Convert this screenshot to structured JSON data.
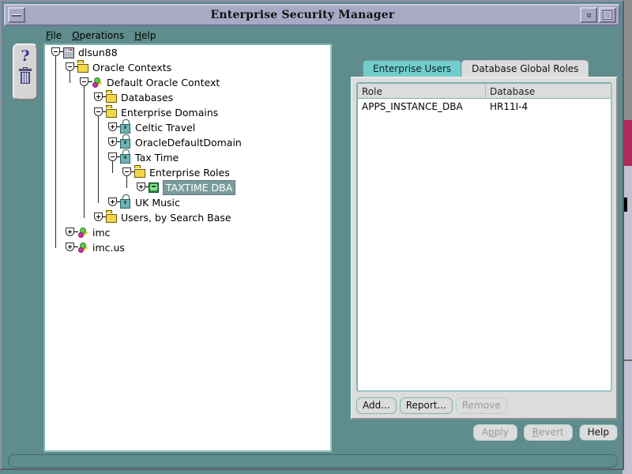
{
  "window": {
    "title": "Enterprise Security Manager",
    "menu_button_icon": "window-menu-icon",
    "minimize_icon": "minimize-icon",
    "maximize_icon": "maximize-icon"
  },
  "menubar": {
    "items": [
      {
        "label": "File",
        "mnemonic": "F"
      },
      {
        "label": "Operations",
        "mnemonic": "O"
      },
      {
        "label": "Help",
        "mnemonic": "H"
      }
    ]
  },
  "toolbar": {
    "help_icon": "question-mark-icon",
    "help_glyph": "?",
    "delete_icon": "trash-can-icon"
  },
  "tree": {
    "nodes": [
      {
        "label": "dlsun88",
        "depth": 0,
        "icon": "host-icon",
        "expander": "collapse-handle"
      },
      {
        "label": "Oracle Contexts",
        "depth": 1,
        "icon": "folder-icon",
        "expander": "collapse-handle"
      },
      {
        "label": "Default Oracle Context",
        "depth": 2,
        "icon": "context-icon",
        "expander": "collapse-handle"
      },
      {
        "label": "Databases",
        "depth": 3,
        "icon": "folder-icon",
        "expander": "expand-handle"
      },
      {
        "label": "Enterprise Domains",
        "depth": 3,
        "icon": "folder-icon",
        "expander": "collapse-handle"
      },
      {
        "label": "Celtic Travel",
        "depth": 4,
        "icon": "lock-icon",
        "expander": "expand-handle"
      },
      {
        "label": "OracleDefaultDomain",
        "depth": 4,
        "icon": "lock-icon",
        "expander": "expand-handle"
      },
      {
        "label": "Tax Time",
        "depth": 4,
        "icon": "lock-icon",
        "expander": "collapse-handle"
      },
      {
        "label": "Enterprise Roles",
        "depth": 5,
        "icon": "folder-icon",
        "expander": "collapse-handle"
      },
      {
        "label": "TAXTIME DBA",
        "depth": 6,
        "icon": "role-icon",
        "expander": "expand-handle",
        "selected": true
      },
      {
        "label": "UK Music",
        "depth": 4,
        "icon": "lock-icon",
        "expander": "expand-handle"
      },
      {
        "label": "Users, by Search Base",
        "depth": 3,
        "icon": "folder-icon",
        "expander": "expand-handle"
      },
      {
        "label": "imc",
        "depth": 1,
        "icon": "context-icon",
        "expander": "expand-handle"
      },
      {
        "label": "imc.us",
        "depth": 1,
        "icon": "context-icon",
        "expander": "expand-handle"
      }
    ]
  },
  "right_panel": {
    "tabs": [
      {
        "label": "Enterprise Users",
        "active": false
      },
      {
        "label": "Database Global Roles",
        "active": true
      }
    ],
    "table": {
      "columns": [
        "Role",
        "Database"
      ],
      "rows": [
        {
          "role": "APPS_INSTANCE_DBA",
          "database": "HR11I-4"
        }
      ]
    },
    "actions": [
      {
        "label": "Add...",
        "enabled": true
      },
      {
        "label": "Report...",
        "enabled": true
      },
      {
        "label": "Remove",
        "enabled": false
      }
    ]
  },
  "bottom_actions": [
    {
      "label": "Apply",
      "mnemonic": "p",
      "enabled": false
    },
    {
      "label": "Revert",
      "mnemonic": "R",
      "enabled": false
    },
    {
      "label": "Help",
      "mnemonic": "",
      "enabled": true
    }
  ],
  "status_bar": {
    "text": ""
  },
  "colors": {
    "desktop": "#5f8c8c",
    "titlebar": "#a9a9c6",
    "panel": "#dcdcdc",
    "tab_inactive": "#73cdcd",
    "selection": "#7c9c9c",
    "border_teal": "#7fb0b0"
  }
}
